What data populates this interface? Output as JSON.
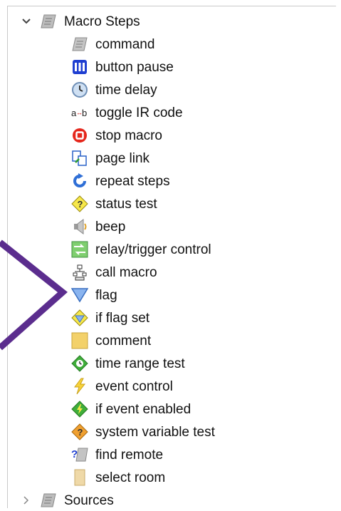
{
  "tree": {
    "parent": {
      "label": "Macro Steps",
      "expanded": true,
      "icon": "macro-steps-icon"
    },
    "items": [
      {
        "label": "command",
        "icon": "command-icon"
      },
      {
        "label": "button pause",
        "icon": "button-pause-icon"
      },
      {
        "label": "time delay",
        "icon": "clock-icon"
      },
      {
        "label": "toggle IR code",
        "icon": "toggle-ir-icon"
      },
      {
        "label": "stop macro",
        "icon": "stop-icon"
      },
      {
        "label": "page link",
        "icon": "page-link-icon"
      },
      {
        "label": "repeat steps",
        "icon": "repeat-icon"
      },
      {
        "label": "status test",
        "icon": "status-test-icon"
      },
      {
        "label": "beep",
        "icon": "speaker-icon"
      },
      {
        "label": "relay/trigger control",
        "icon": "relay-icon"
      },
      {
        "label": "call macro",
        "icon": "call-macro-icon"
      },
      {
        "label": "flag",
        "icon": "flag-icon"
      },
      {
        "label": "if flag set",
        "icon": "if-flag-icon"
      },
      {
        "label": "comment",
        "icon": "comment-icon"
      },
      {
        "label": "time range test",
        "icon": "time-range-icon"
      },
      {
        "label": "event control",
        "icon": "lightning-icon"
      },
      {
        "label": "if event enabled",
        "icon": "if-event-icon"
      },
      {
        "label": "system variable test",
        "icon": "system-variable-icon"
      },
      {
        "label": "find remote",
        "icon": "find-remote-icon"
      },
      {
        "label": "select room",
        "icon": "select-room-icon"
      }
    ],
    "sibling": {
      "label": "Sources",
      "expanded": false,
      "icon": "sources-icon"
    }
  },
  "colors": {
    "annotation_arrow": "#5b2d8e",
    "tree_border": "#c9c9c9"
  }
}
